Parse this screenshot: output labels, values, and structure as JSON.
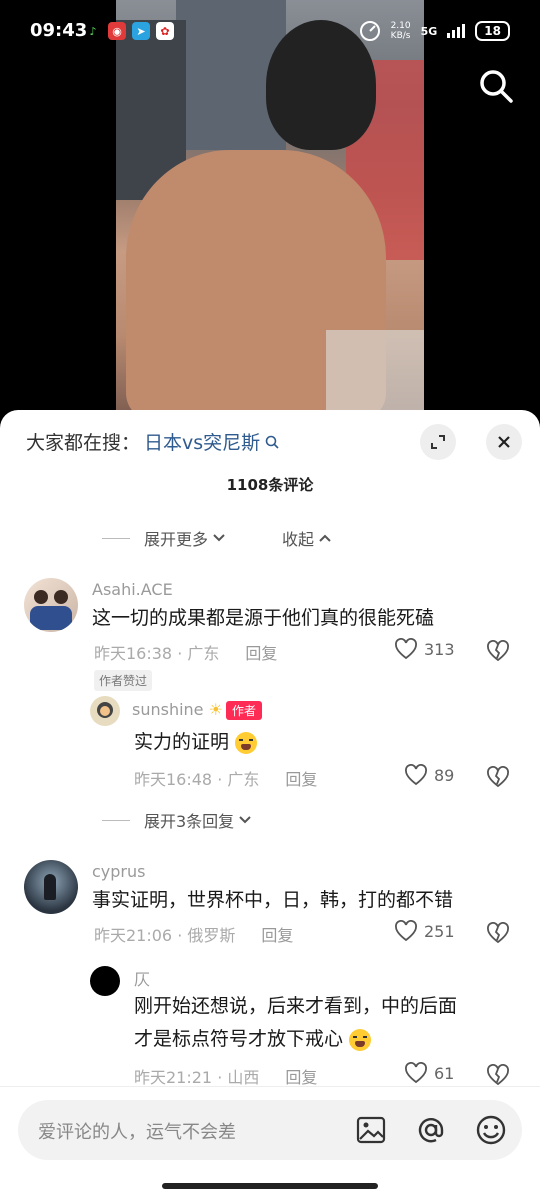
{
  "status_bar": {
    "time": "09:43",
    "speed_value": "2.10",
    "speed_unit": "KB/s",
    "network": "5G",
    "battery": "18"
  },
  "hot_search": {
    "prefix": "大家都在搜：",
    "term": "日本vs突尼斯"
  },
  "comments_count": "1108条评论",
  "controls": {
    "expand_more": "展开更多",
    "collapse": "收起",
    "expand_replies": "展开3条回复"
  },
  "comments": [
    {
      "user": "Asahi.ACE",
      "text": "这一切的成果都是源于他们真的很能死磕",
      "time_loc": "昨天16:38 · 广东",
      "reply": "回复",
      "likes": "313",
      "badge": "作者赞过",
      "replies": [
        {
          "user": "sunshine",
          "tag": "作者",
          "text": "实力的证明",
          "time_loc": "昨天16:48 · 广东",
          "reply": "回复",
          "likes": "89"
        }
      ]
    },
    {
      "user": "cyprus",
      "text": "事实证明，世界杯中，日，韩，打的都不错",
      "time_loc": "昨天21:06 · 俄罗斯",
      "reply": "回复",
      "likes": "251",
      "replies": [
        {
          "user": "仄",
          "text_line1": "刚开始还想说，后来才看到，中的后面",
          "text_line2": "才是标点符号才放下戒心",
          "time_loc": "昨天21:21 · 山西",
          "reply": "回复",
          "likes": "61"
        }
      ]
    }
  ],
  "input": {
    "placeholder": "爱评论的人，运气不会差"
  },
  "icons": [
    "search-icon",
    "fullscreen-icon",
    "close-icon",
    "heart-icon",
    "broken-heart-icon",
    "image-icon",
    "at-icon",
    "emoji-icon"
  ],
  "colors": {
    "author_tag": "#fe2c55",
    "hot_term": "#2f5b8f"
  }
}
